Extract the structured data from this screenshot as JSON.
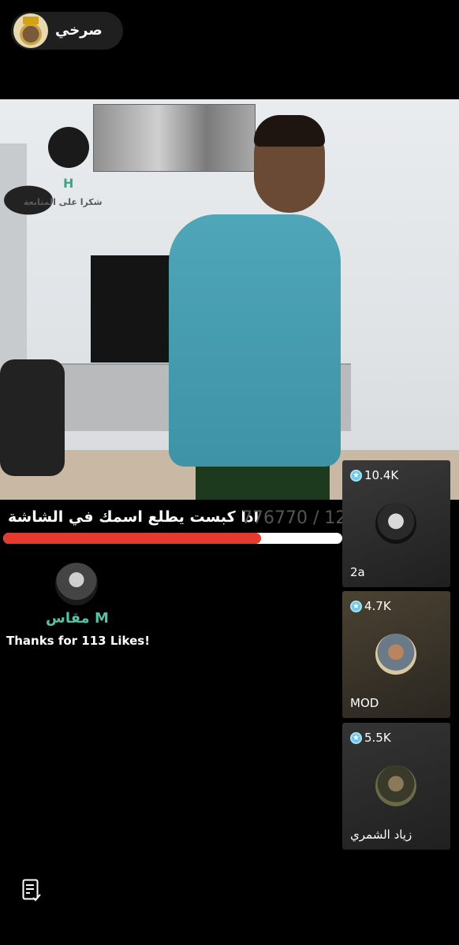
{
  "host": {
    "name": "صرخي"
  },
  "video": {
    "overlay_letter": "H",
    "overlay_caption": "شكرا على المتابعة"
  },
  "goal": {
    "text": "اذا كبست يطلع اسمك في الشاشة",
    "count": "776770 / 128",
    "progress_fraction": 0.76
  },
  "like_thanks": {
    "user_name": "مقاس M",
    "message": "Thanks for 113 Likes!"
  },
  "gifters": [
    {
      "coins": "10.4K",
      "label": "2a"
    },
    {
      "coins": "4.7K",
      "label": "MOD"
    },
    {
      "coins": "5.5K",
      "label": "زياد الشمري"
    }
  ],
  "icons": {
    "coin": "coin-icon",
    "bottom": "document-check-icon"
  }
}
